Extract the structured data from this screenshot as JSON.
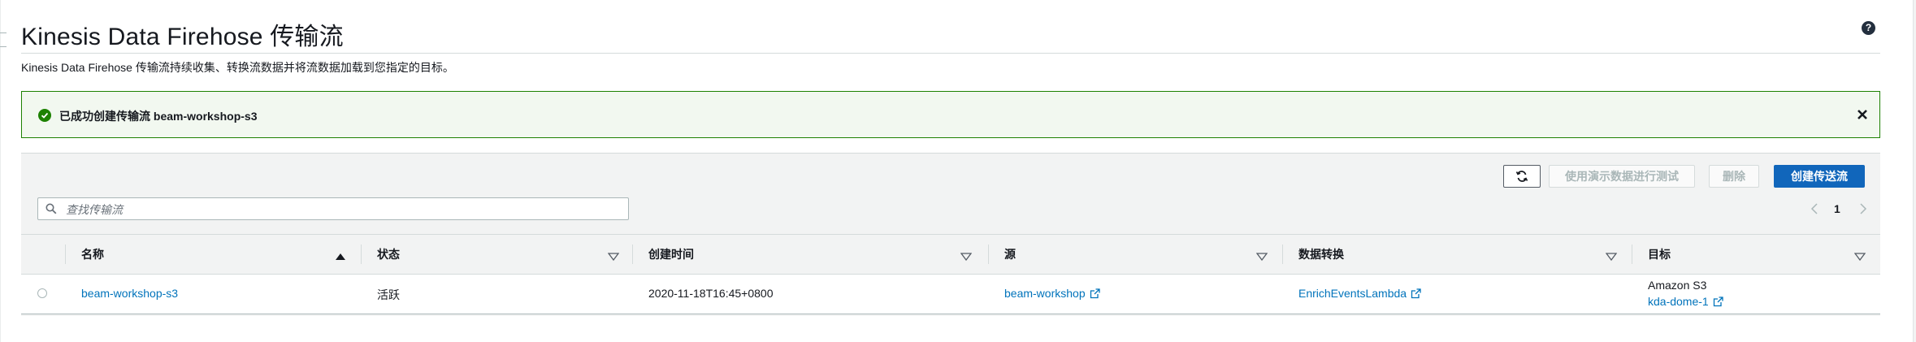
{
  "page": {
    "title": "Kinesis Data Firehose 传输流",
    "description": "Kinesis Data Firehose 传输流持续收集、转换流数据并将流数据加载到您指定的目标。"
  },
  "flash": {
    "message": "已成功创建传输流 beam-workshop-s3",
    "status_color": "#1d8102"
  },
  "toolbar": {
    "refresh_icon": "refresh-icon",
    "test_label": "使用演示数据进行测试",
    "delete_label": "删除",
    "create_label": "创建传送流",
    "primary_color": "#1166bb"
  },
  "search": {
    "placeholder": "查找传输流",
    "value": ""
  },
  "pagination": {
    "current_page": "1"
  },
  "table": {
    "columns": [
      "名称",
      "状态",
      "创建时间",
      "源",
      "数据转换",
      "目标"
    ],
    "rows": [
      {
        "name": "beam-workshop-s3",
        "status": "活跃",
        "created": "2020-11-18T16:45+0800",
        "source": "beam-workshop",
        "transform": "EnrichEventsLambda",
        "destination_type": "Amazon S3",
        "destination_name": "kda-dome-1"
      }
    ]
  },
  "colors": {
    "link": "#0073bb",
    "text": "#16191f"
  }
}
